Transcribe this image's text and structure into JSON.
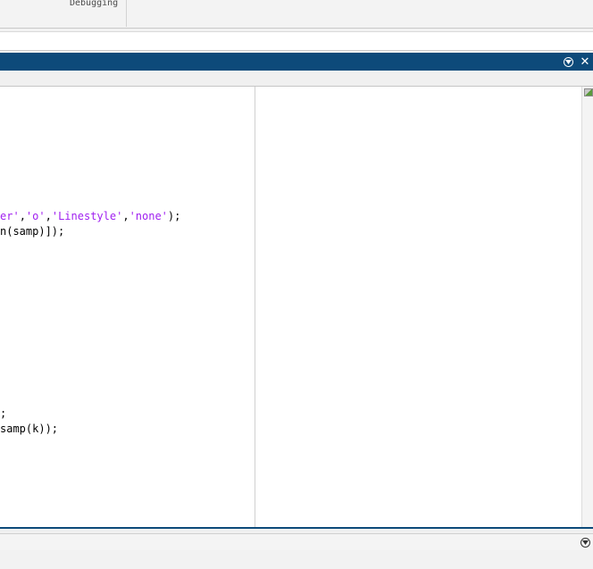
{
  "toolstrip": {
    "section_label": "Debugging"
  },
  "editor": {
    "code_lines": [
      {
        "segments": [
          {
            "text": "er'",
            "string": true
          },
          {
            "text": ",",
            "string": false
          },
          {
            "text": "'o'",
            "string": true
          },
          {
            "text": ",",
            "string": false
          },
          {
            "text": "'Linestyle'",
            "string": true
          },
          {
            "text": ",",
            "string": false
          },
          {
            "text": "'none'",
            "string": true
          },
          {
            "text": ");",
            "string": false
          }
        ]
      },
      {
        "segments": [
          {
            "text": "n(samp)]);",
            "string": false
          }
        ]
      },
      {
        "segments": [
          {
            "text": ";",
            "string": false
          }
        ]
      },
      {
        "segments": [
          {
            "text": "samp(k));",
            "string": false
          }
        ]
      }
    ],
    "title_buttons": {
      "minimize_icon": "circle-down-arrow-icon",
      "close_icon": "close-icon",
      "close_glyph": "✕"
    }
  },
  "colors": {
    "titlebar": "#0d4a7a",
    "string_literal": "#a020f0",
    "code_text": "#000000"
  },
  "bottom_panel": {
    "expand_icon": "circle-down-arrow-icon"
  }
}
